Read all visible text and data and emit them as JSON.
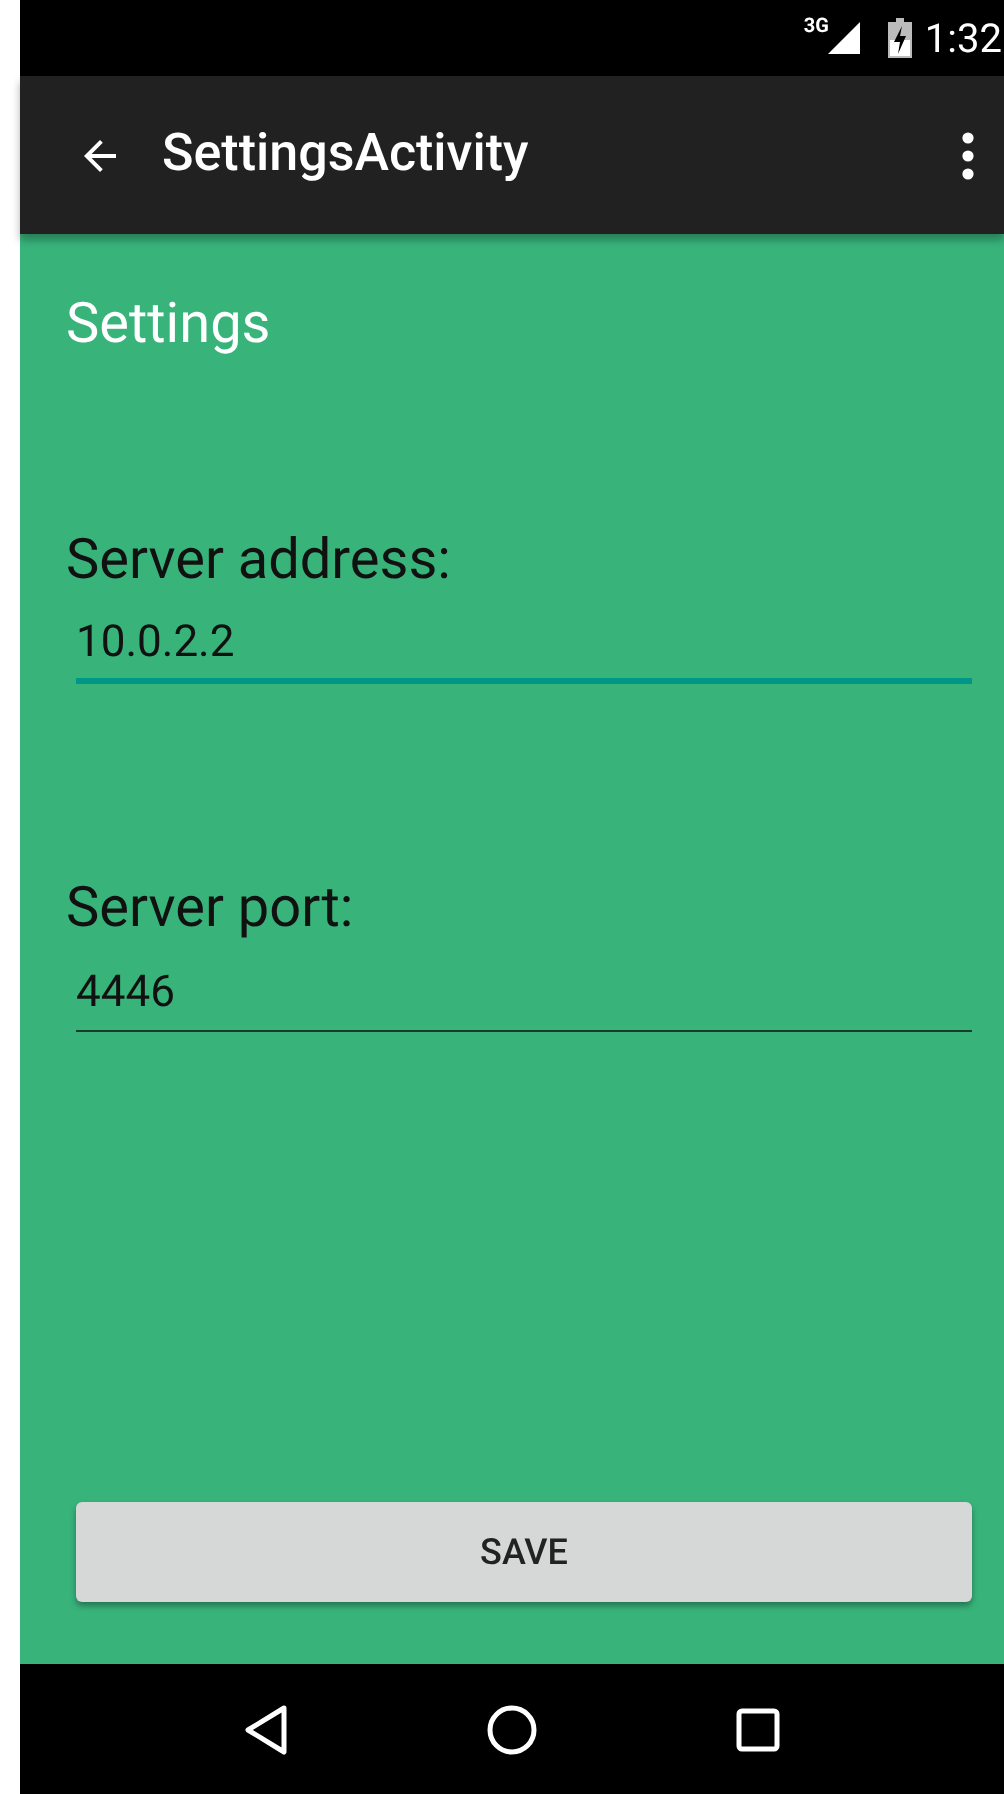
{
  "status_bar": {
    "network": "3G",
    "time": "1:32"
  },
  "app_bar": {
    "title": "SettingsActivity"
  },
  "heading": "Settings",
  "fields": [
    {
      "label": "Server address:",
      "value": "10.0.2.2",
      "focused": true
    },
    {
      "label": "Server port:",
      "value": "4446",
      "focused": false
    }
  ],
  "save_button": "SAVE"
}
